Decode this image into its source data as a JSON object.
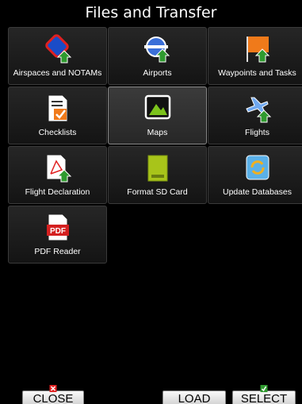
{
  "header": {
    "title": "Files and Transfer"
  },
  "tiles": [
    {
      "label": "Airspaces and NOTAMs",
      "icon": "airspaces-icon"
    },
    {
      "label": "Airports",
      "icon": "airports-icon"
    },
    {
      "label": "Waypoints and Tasks",
      "icon": "waypoints-icon"
    },
    {
      "label": "Checklists",
      "icon": "checklist-icon"
    },
    {
      "label": "Maps",
      "icon": "maps-icon"
    },
    {
      "label": "Flights",
      "icon": "flights-icon"
    },
    {
      "label": "Flight Declaration",
      "icon": "flight-declaration-icon"
    },
    {
      "label": "Format SD Card",
      "icon": "sd-card-icon"
    },
    {
      "label": "Update Databases",
      "icon": "update-databases-icon"
    },
    {
      "label": "PDF Reader",
      "icon": "pdf-icon"
    }
  ],
  "selected_tile": "Maps",
  "pdf_icon_text": "PDF",
  "footer": {
    "close_label": "CLOSE",
    "load_label": "LOAD",
    "select_label": "SELECT"
  },
  "colors": {
    "accent_green": "#2f9a2f",
    "accent_orange": "#f07a1a",
    "accent_blue": "#3a6fd8",
    "pdf_red": "#d42020"
  }
}
